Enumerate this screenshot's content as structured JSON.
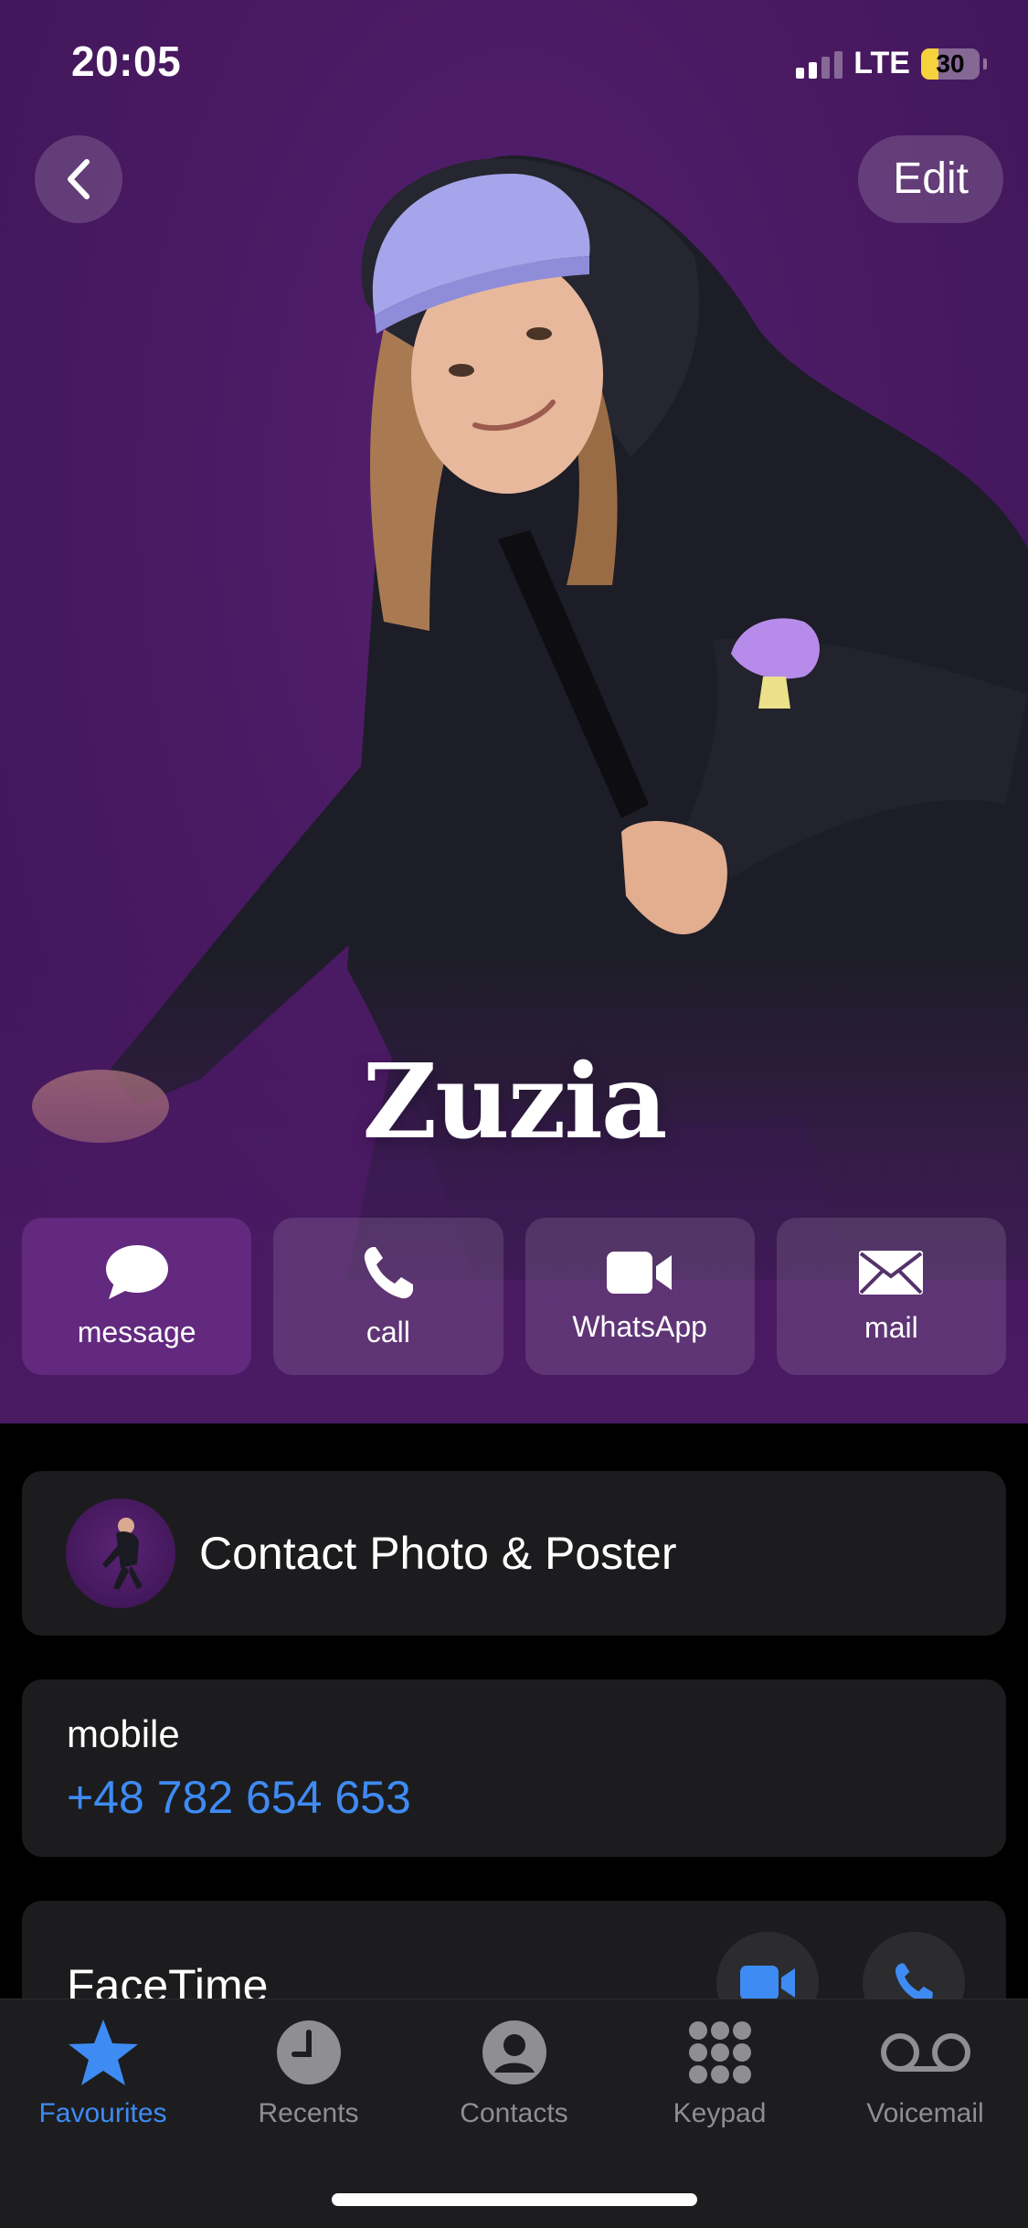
{
  "status_bar": {
    "time": "20:05",
    "network": "LTE",
    "battery": "30",
    "battery_level": 0.3
  },
  "nav": {
    "edit_label": "Edit"
  },
  "contact": {
    "name": "Zuzia"
  },
  "actions": [
    {
      "label": "message",
      "icon": "message-bubble-icon"
    },
    {
      "label": "call",
      "icon": "phone-icon"
    },
    {
      "label": "WhatsApp",
      "icon": "video-camera-icon"
    },
    {
      "label": "mail",
      "icon": "envelope-icon"
    }
  ],
  "details": {
    "poster_label": "Contact Photo & Poster",
    "phone_label": "mobile",
    "phone_number": "+48 782 654 653",
    "facetime_label": "FaceTime"
  },
  "tab_bar": {
    "tabs": [
      {
        "label": "Favourites",
        "icon": "star-icon",
        "active": true
      },
      {
        "label": "Recents",
        "icon": "clock-icon",
        "active": false
      },
      {
        "label": "Contacts",
        "icon": "person-circle-icon",
        "active": false
      },
      {
        "label": "Keypad",
        "icon": "keypad-icon",
        "active": false
      },
      {
        "label": "Voicemail",
        "icon": "voicemail-icon",
        "active": false
      }
    ]
  },
  "colors": {
    "poster_background": "#4a1a63",
    "accent_blue": "#3e8bf4",
    "card_background": "#1c1c1e"
  }
}
